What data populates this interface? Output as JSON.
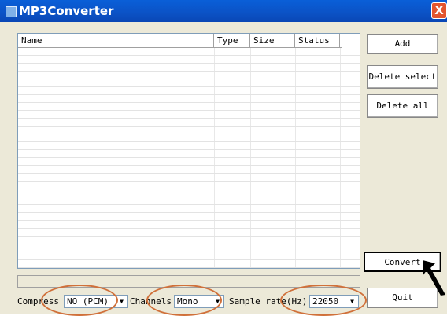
{
  "window": {
    "title": "MP3Converter",
    "close_label": "X"
  },
  "list": {
    "columns": [
      "Name",
      "Type",
      "Size",
      "Status"
    ]
  },
  "buttons": {
    "add": "Add",
    "delete_select": "Delete select",
    "delete_all": "Delete all",
    "convert": "Convert",
    "quit": "Quit"
  },
  "options": {
    "compress_label": "Compress",
    "compress_value": "NO (PCM)",
    "channels_label": "Channels",
    "channels_value": "Mono",
    "sample_rate_label": "Sample rate(Hz)",
    "sample_rate_value": "22050"
  },
  "colors": {
    "highlight_ring": "#d0703a",
    "titlebar": "#0a5fd8"
  }
}
